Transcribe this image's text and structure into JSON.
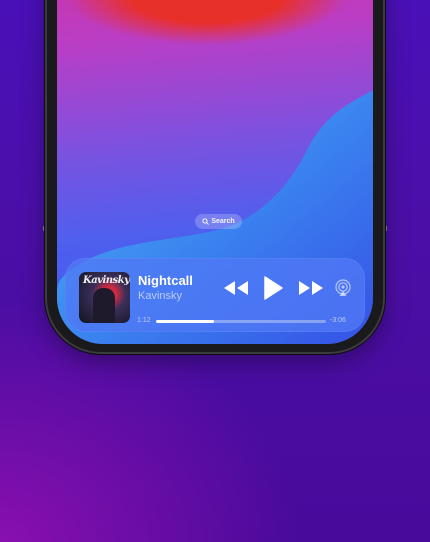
{
  "screen": {
    "search_label": "Search"
  },
  "now_playing": {
    "track_title": "Nightcall",
    "artist": "Kavinsky",
    "album_art_text": "Kavinsky",
    "elapsed": "1:12",
    "remaining": "-3:06",
    "progress_fraction": 0.34
  },
  "icons": {
    "search": "search-icon",
    "rewind": "rewind-icon",
    "play": "play-icon",
    "fast_forward": "fast-forward-icon",
    "airplay": "airplay-icon"
  },
  "colors": {
    "player_bg": "#5078f5",
    "progress_fill": "#ffffff",
    "accent_red": "#e8302a"
  }
}
